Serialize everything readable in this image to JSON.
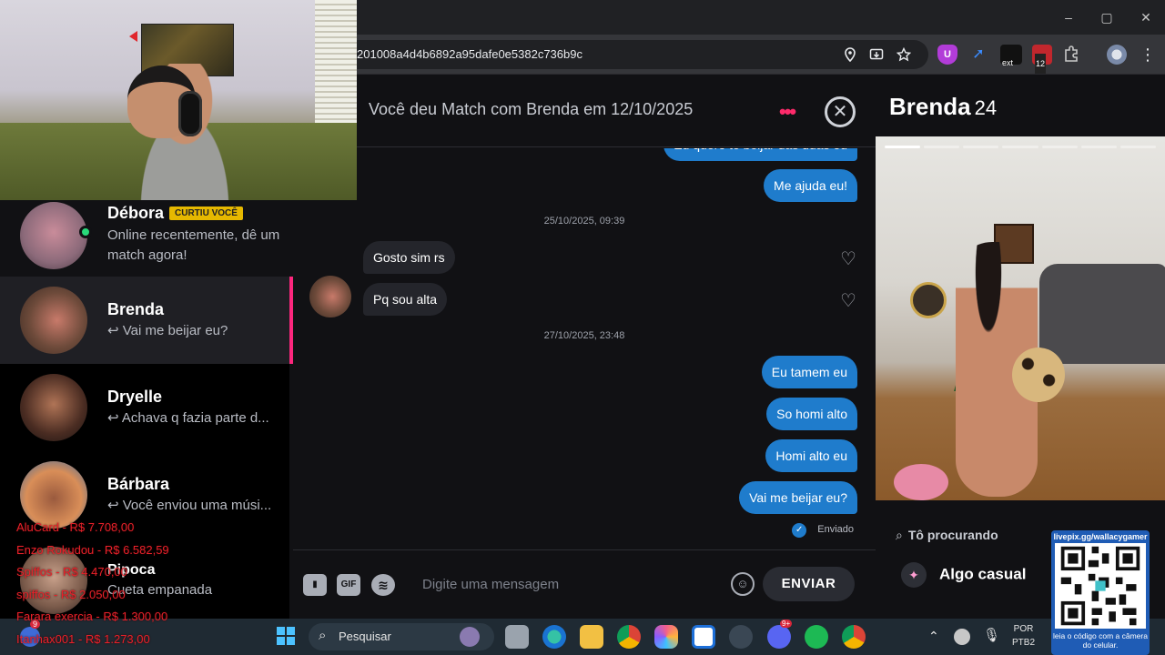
{
  "browser": {
    "url": "201008a4d4b6892a95dafe0e5382c736b9c",
    "ext_label": "ext",
    "ext_count": "12",
    "window": {
      "minimize": "–",
      "maximize": "▢",
      "close": "✕"
    }
  },
  "matches": [
    {
      "name": "Débora",
      "badge": "CURTIU VOCÊ",
      "message": "Online recentemente, dê um match agora!",
      "online": true
    },
    {
      "name": "Brenda",
      "message": "↩ Vai me beijar eu?",
      "active": true
    },
    {
      "name": "Dryelle",
      "message": "↩ Achava q fazia parte d..."
    },
    {
      "name": "Bárbara",
      "message": "↩ Você enviou uma músi..."
    },
    {
      "name": "Pipoca",
      "message": "Cueta empanada"
    }
  ],
  "donations": [
    "AluCard - R$ 7.708,00",
    "Enzo Rokudou - R$ 6.582,59",
    "Spiffos - R$ 4.470,00",
    "spiffos - R$ 2.050,00",
    "Farara exercia - R$ 1.300,00",
    "Itanhax001 - R$ 1.273,00"
  ],
  "chat": {
    "header": "Você deu Match com Brenda em 12/10/2025",
    "partial_top": "Eu quero te beijar das duas eu",
    "msg_help": "Me ajuda eu!",
    "ts1": "25/10/2025, 09:39",
    "in1": "Gosto sim rs",
    "in2": "Pq sou alta",
    "ts2": "27/10/2025, 23:48",
    "out1": "Eu tamem eu",
    "out2": "So homi alto",
    "out3": "Homi alto eu",
    "out4": "Vai me beijar eu?",
    "status": "Enviado",
    "placeholder": "Digite uma mensagem",
    "gif": "GIF",
    "send": "ENVIAR"
  },
  "profile": {
    "name": "Brenda",
    "age": "24",
    "looking_label": "Tô procurando",
    "looking_value": "Algo casual"
  },
  "qr": {
    "top": "livepix.gg/wallacygamer",
    "bottom": "leia o código com a câmera do celular."
  },
  "taskbar": {
    "search": "Pesquisar",
    "lang1": "POR",
    "lang2": "PTB2",
    "notif_count": "9",
    "discord_count": "9+"
  },
  "colors": {
    "accent": "#fd267d",
    "bubble_out": "#1f7ccc",
    "bubble_in": "#24252b",
    "background": "#111114",
    "donation": "#e8212a",
    "badge": "#e6b800"
  }
}
